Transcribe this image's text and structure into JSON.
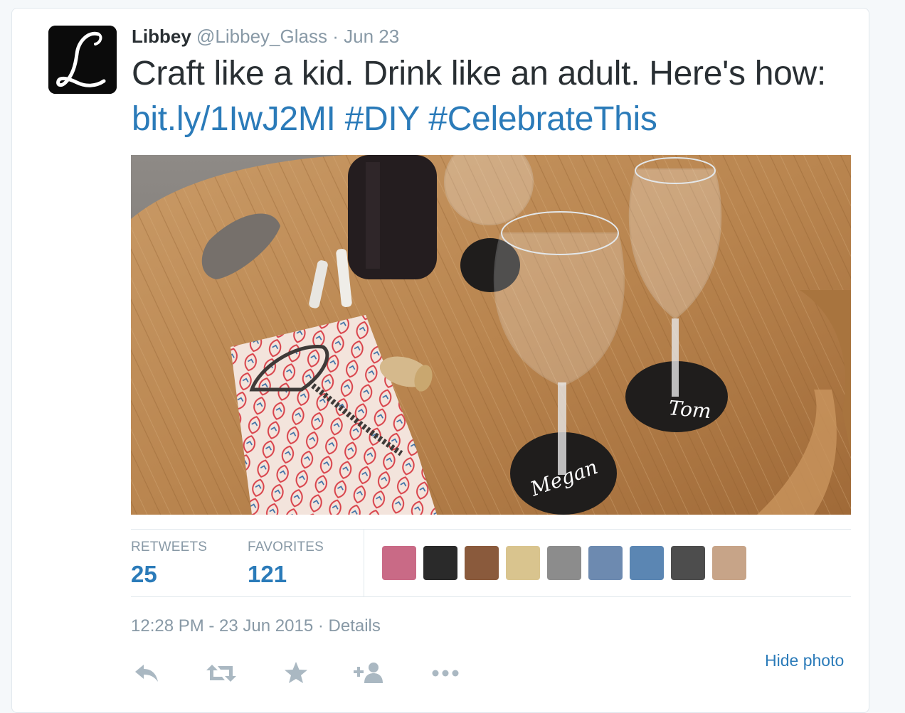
{
  "tweet": {
    "author_name": "Libbey",
    "author_handle": "@Libbey_Glass",
    "separator": "·",
    "date": "Jun 23",
    "avatar_letter": "L",
    "text_main": "Craft like a kid. Drink like an adult. Here's how: ",
    "link": "bit.ly/1IwJ2MI",
    "hashtag_1": "#DIY",
    "hashtag_2": "#CelebrateThis"
  },
  "photo": {
    "glass_label_1": "Tom",
    "glass_label_2": "Megan"
  },
  "stats": {
    "retweets_label": "RETWEETS",
    "retweets_count": "25",
    "favorites_label": "FAVORITES",
    "favorites_count": "121"
  },
  "favoriters": [
    {
      "name": "favoriter-1",
      "bg": "#c96a86"
    },
    {
      "name": "favoriter-2",
      "bg": "#2a2a2a"
    },
    {
      "name": "favoriter-3",
      "bg": "#8a5a3c"
    },
    {
      "name": "favoriter-4",
      "bg": "#d9c48e"
    },
    {
      "name": "favoriter-5",
      "bg": "#8c8c8c"
    },
    {
      "name": "favoriter-6",
      "bg": "#6d8ab0"
    },
    {
      "name": "favoriter-7",
      "bg": "#5b86b3"
    },
    {
      "name": "favoriter-8",
      "bg": "#4d4d4d"
    },
    {
      "name": "favoriter-9",
      "bg": "#c7a488"
    }
  ],
  "footer": {
    "timestamp": "12:28 PM - 23 Jun 2015",
    "separator": "·",
    "details_link": "Details",
    "hide_photo": "Hide photo"
  },
  "actions": [
    "reply-icon",
    "retweet-icon",
    "favorite-icon",
    "follow-icon",
    "more-icon"
  ],
  "colors": {
    "link": "#2b7bb9",
    "muted": "#8899a6",
    "text": "#292f33",
    "border": "#e1e8ed"
  }
}
